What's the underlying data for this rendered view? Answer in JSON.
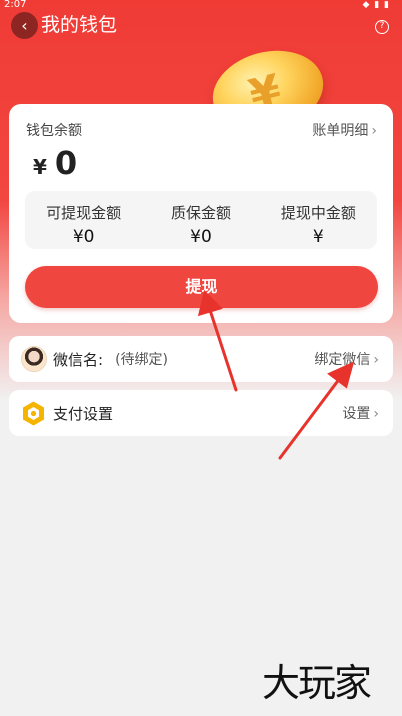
{
  "status_bar": {
    "time": "2:07",
    "icons": "◆ ▮ ▮"
  },
  "header": {
    "title": "我的钱包",
    "back_icon": "chevron-left-icon",
    "help_icon": "question-circle-icon"
  },
  "wallet": {
    "balance_label": "钱包余额",
    "detail_link": "账单明细",
    "currency": "¥",
    "balance": "0",
    "stats": [
      {
        "label": "可提现金额",
        "value": "¥0"
      },
      {
        "label": "质保金额",
        "value": "¥0"
      },
      {
        "label": "提现中金额",
        "value": "¥"
      }
    ],
    "withdraw_button": "提现"
  },
  "wechat": {
    "title": "微信名:",
    "status": "(待绑定)",
    "action": "绑定微信"
  },
  "payment": {
    "title": "支付设置",
    "action": "设置"
  },
  "watermark": "大玩家",
  "colors": {
    "brand_red": "#ef4640",
    "accent_orange": "#f5b400"
  }
}
